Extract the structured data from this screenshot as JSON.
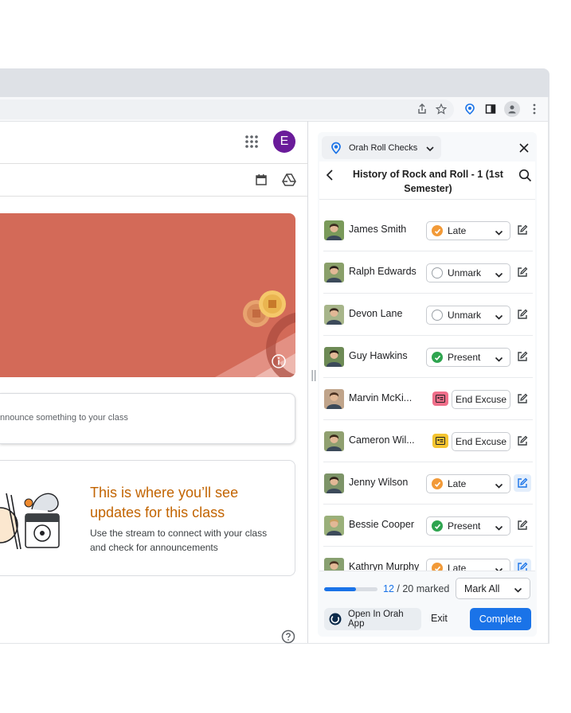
{
  "classroom": {
    "avatar_letter": "E",
    "announce_placeholder": "nnounce something to your class",
    "updates_title": "This is where you’ll see updates for this class",
    "updates_body": "Use the stream to connect with your class and check for announcements"
  },
  "panel": {
    "extension_name": "Orah Roll Checks",
    "class_title": "History of Rock and Roll - 1 (1st Semester)",
    "students": [
      {
        "name": "James Smith",
        "status": "Late",
        "kind": "select"
      },
      {
        "name": "Ralph Edwards",
        "status": "Unmark",
        "kind": "select"
      },
      {
        "name": "Devon Lane",
        "status": "Unmark",
        "kind": "select"
      },
      {
        "name": "Guy Hawkins",
        "status": "Present",
        "kind": "select"
      },
      {
        "name": "Marvin McKi...",
        "status": "End Excuse",
        "kind": "excuse"
      },
      {
        "name": "Cameron Wil...",
        "status": "End Excuse",
        "kind": "excuse"
      },
      {
        "name": "Jenny Wilson",
        "status": "Late",
        "kind": "select"
      },
      {
        "name": "Bessie Cooper",
        "status": "Present",
        "kind": "select"
      },
      {
        "name": "Kathryn Murphy",
        "status": "Late",
        "kind": "select"
      }
    ],
    "progress": {
      "marked": "12",
      "total_text": " / 20 marked",
      "fraction": 0.6
    },
    "mark_all_label": "Mark All",
    "open_app_label": "Open In Orah App",
    "exit_label": "Exit",
    "complete_label": "Complete"
  },
  "colors": {
    "accent": "#1a73e8",
    "late": "#f29a38",
    "present": "#2ea44f",
    "banner": "#d36a58",
    "excuse_pink": "#f06f8a",
    "excuse_yellow": "#f4c430"
  }
}
